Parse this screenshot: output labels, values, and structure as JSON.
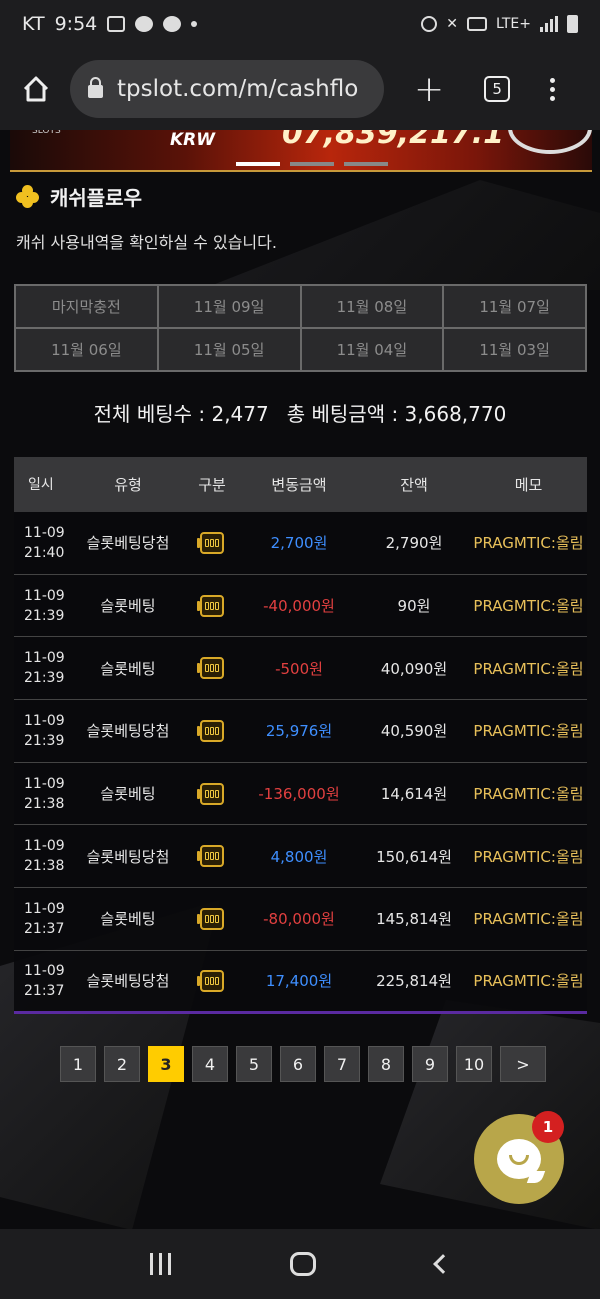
{
  "status_bar": {
    "carrier": "KT",
    "time": "9:54",
    "network": "LTE+"
  },
  "browser": {
    "url": "tpslot.com/m/cashflo",
    "tab_count": "5"
  },
  "banner": {
    "currency": "KRW",
    "amount": "07,839,217.1"
  },
  "section": {
    "title": "캐쉬플로우",
    "description": "캐쉬 사용내역을 확인하실 수 있습니다."
  },
  "date_filters": [
    "마지막충전",
    "11월 09일",
    "11월 08일",
    "11월 07일",
    "11월 06일",
    "11월 05일",
    "11월 04일",
    "11월 03일"
  ],
  "totals": {
    "bet_count": "전체 베팅수 : 2,477",
    "bet_amount": "총 베팅금액 : 3,668,770"
  },
  "table": {
    "headers": [
      "일시",
      "유형",
      "구분",
      "변동금액",
      "잔액",
      "메모"
    ],
    "rows": [
      {
        "date": "11-09",
        "time": "21:40",
        "type": "슬롯베팅당첨",
        "amount": "2,700원",
        "sign": "plus",
        "balance": "2,790원",
        "memo": "PRAGMTIC:올림"
      },
      {
        "date": "11-09",
        "time": "21:39",
        "type": "슬롯베팅",
        "amount": "-40,000원",
        "sign": "minus",
        "balance": "90원",
        "memo": "PRAGMTIC:올림"
      },
      {
        "date": "11-09",
        "time": "21:39",
        "type": "슬롯베팅",
        "amount": "-500원",
        "sign": "minus",
        "balance": "40,090원",
        "memo": "PRAGMTIC:올림"
      },
      {
        "date": "11-09",
        "time": "21:39",
        "type": "슬롯베팅당첨",
        "amount": "25,976원",
        "sign": "plus",
        "balance": "40,590원",
        "memo": "PRAGMTIC:올림"
      },
      {
        "date": "11-09",
        "time": "21:38",
        "type": "슬롯베팅",
        "amount": "-136,000원",
        "sign": "minus",
        "balance": "14,614원",
        "memo": "PRAGMTIC:올림"
      },
      {
        "date": "11-09",
        "time": "21:38",
        "type": "슬롯베팅당첨",
        "amount": "4,800원",
        "sign": "plus",
        "balance": "150,614원",
        "memo": "PRAGMTIC:올림"
      },
      {
        "date": "11-09",
        "time": "21:37",
        "type": "슬롯베팅",
        "amount": "-80,000원",
        "sign": "minus",
        "balance": "145,814원",
        "memo": "PRAGMTIC:올림"
      },
      {
        "date": "11-09",
        "time": "21:37",
        "type": "슬롯베팅당첨",
        "amount": "17,400원",
        "sign": "plus",
        "balance": "225,814원",
        "memo": "PRAGMTIC:올림"
      }
    ]
  },
  "pagination": {
    "pages": [
      "1",
      "2",
      "3",
      "4",
      "5",
      "6",
      "7",
      "8",
      "9",
      "10"
    ],
    "active": "3",
    "next": ">"
  },
  "chat": {
    "badge": "1"
  },
  "colors": {
    "plus": "#3f8fff",
    "minus": "#e24040",
    "memo": "#e8c05a",
    "active_page": "#ffcc00"
  },
  "icons": {
    "kind": "slot-machine-icon",
    "section": "clover-icon"
  }
}
